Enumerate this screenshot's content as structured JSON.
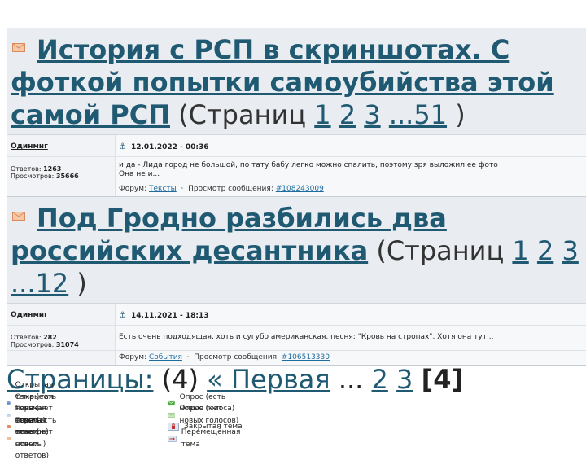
{
  "topics": [
    {
      "title": "История с РСП в скриншотах. С фоткой попытки самоубийства этой самой РСП",
      "pages_open": "(Страниц",
      "pages": [
        "1",
        "2",
        "3",
        "...51"
      ],
      "pages_close": ")",
      "author": "Одинмиг",
      "date": "12.01.2022 - 00:36",
      "replies_label": "Ответов:",
      "replies": "1263",
      "views_label": "Просмотров:",
      "views": "35666",
      "snippet_line1": "и да - Лида город не большой, по тату бабу легко можно спалить, поэтому зря выложил ее фото",
      "snippet_line2": "Она не и...",
      "forum_label": "Форум:",
      "forum": "Тексты",
      "view_msg_label": "Просмотр сообщения:",
      "msg_id": "#108243009"
    },
    {
      "title": "Под Гродно разбились два российских десантника",
      "pages_open": "(Страниц",
      "pages": [
        "1",
        "2",
        "3",
        "...12"
      ],
      "pages_close": ")",
      "author": "Одинмиг",
      "date": "14.11.2021 - 18:13",
      "replies_label": "Ответов:",
      "replies": "282",
      "views_label": "Просмотров:",
      "views": "31074",
      "snippet_line1": "Есть очень подходящая, хоть и сугубо американская, песня: \"Кровь на стропах\". Хотя она тут...",
      "snippet_line2": "",
      "forum_label": "Форум:",
      "forum": "События",
      "view_msg_label": "Просмотр сообщения:",
      "msg_id": "#106513330"
    }
  ],
  "pagination": {
    "label": "Страницы:",
    "count": "(4)",
    "first": "« Первая",
    "ellipsis": "...",
    "p2": "2",
    "p3": "3",
    "current": "[4]"
  },
  "legend": {
    "left": [
      {
        "icon": "envelope-open-new-icon",
        "label": "Открытая тема (есть новые ответы)",
        "color": "#4a7fd0"
      },
      {
        "icon": "envelope-open-icon",
        "label": "Открытая тема (нет новых ответов)",
        "color": "#9ec0e8"
      },
      {
        "icon": "envelope-hot-new-icon",
        "label": "Горячая тема (есть новые ответы)",
        "color": "#e8702a"
      },
      {
        "icon": "envelope-hot-icon",
        "label": "Горячая тема (нет новых ответов)",
        "color": "#f0b48a"
      }
    ],
    "right": [
      {
        "icon": "poll-new-icon",
        "label": "Опрос (есть новые голоса)",
        "color": "#4caf3a"
      },
      {
        "icon": "poll-icon",
        "label": "Опрос (нет новых голосов)",
        "color": "#a8d89a"
      },
      {
        "icon": "lock-icon",
        "label": "Закрытая тема",
        "color": "#c03030"
      },
      {
        "icon": "moved-icon",
        "label": "Перемещённая тема",
        "color": "#d03030"
      }
    ]
  }
}
